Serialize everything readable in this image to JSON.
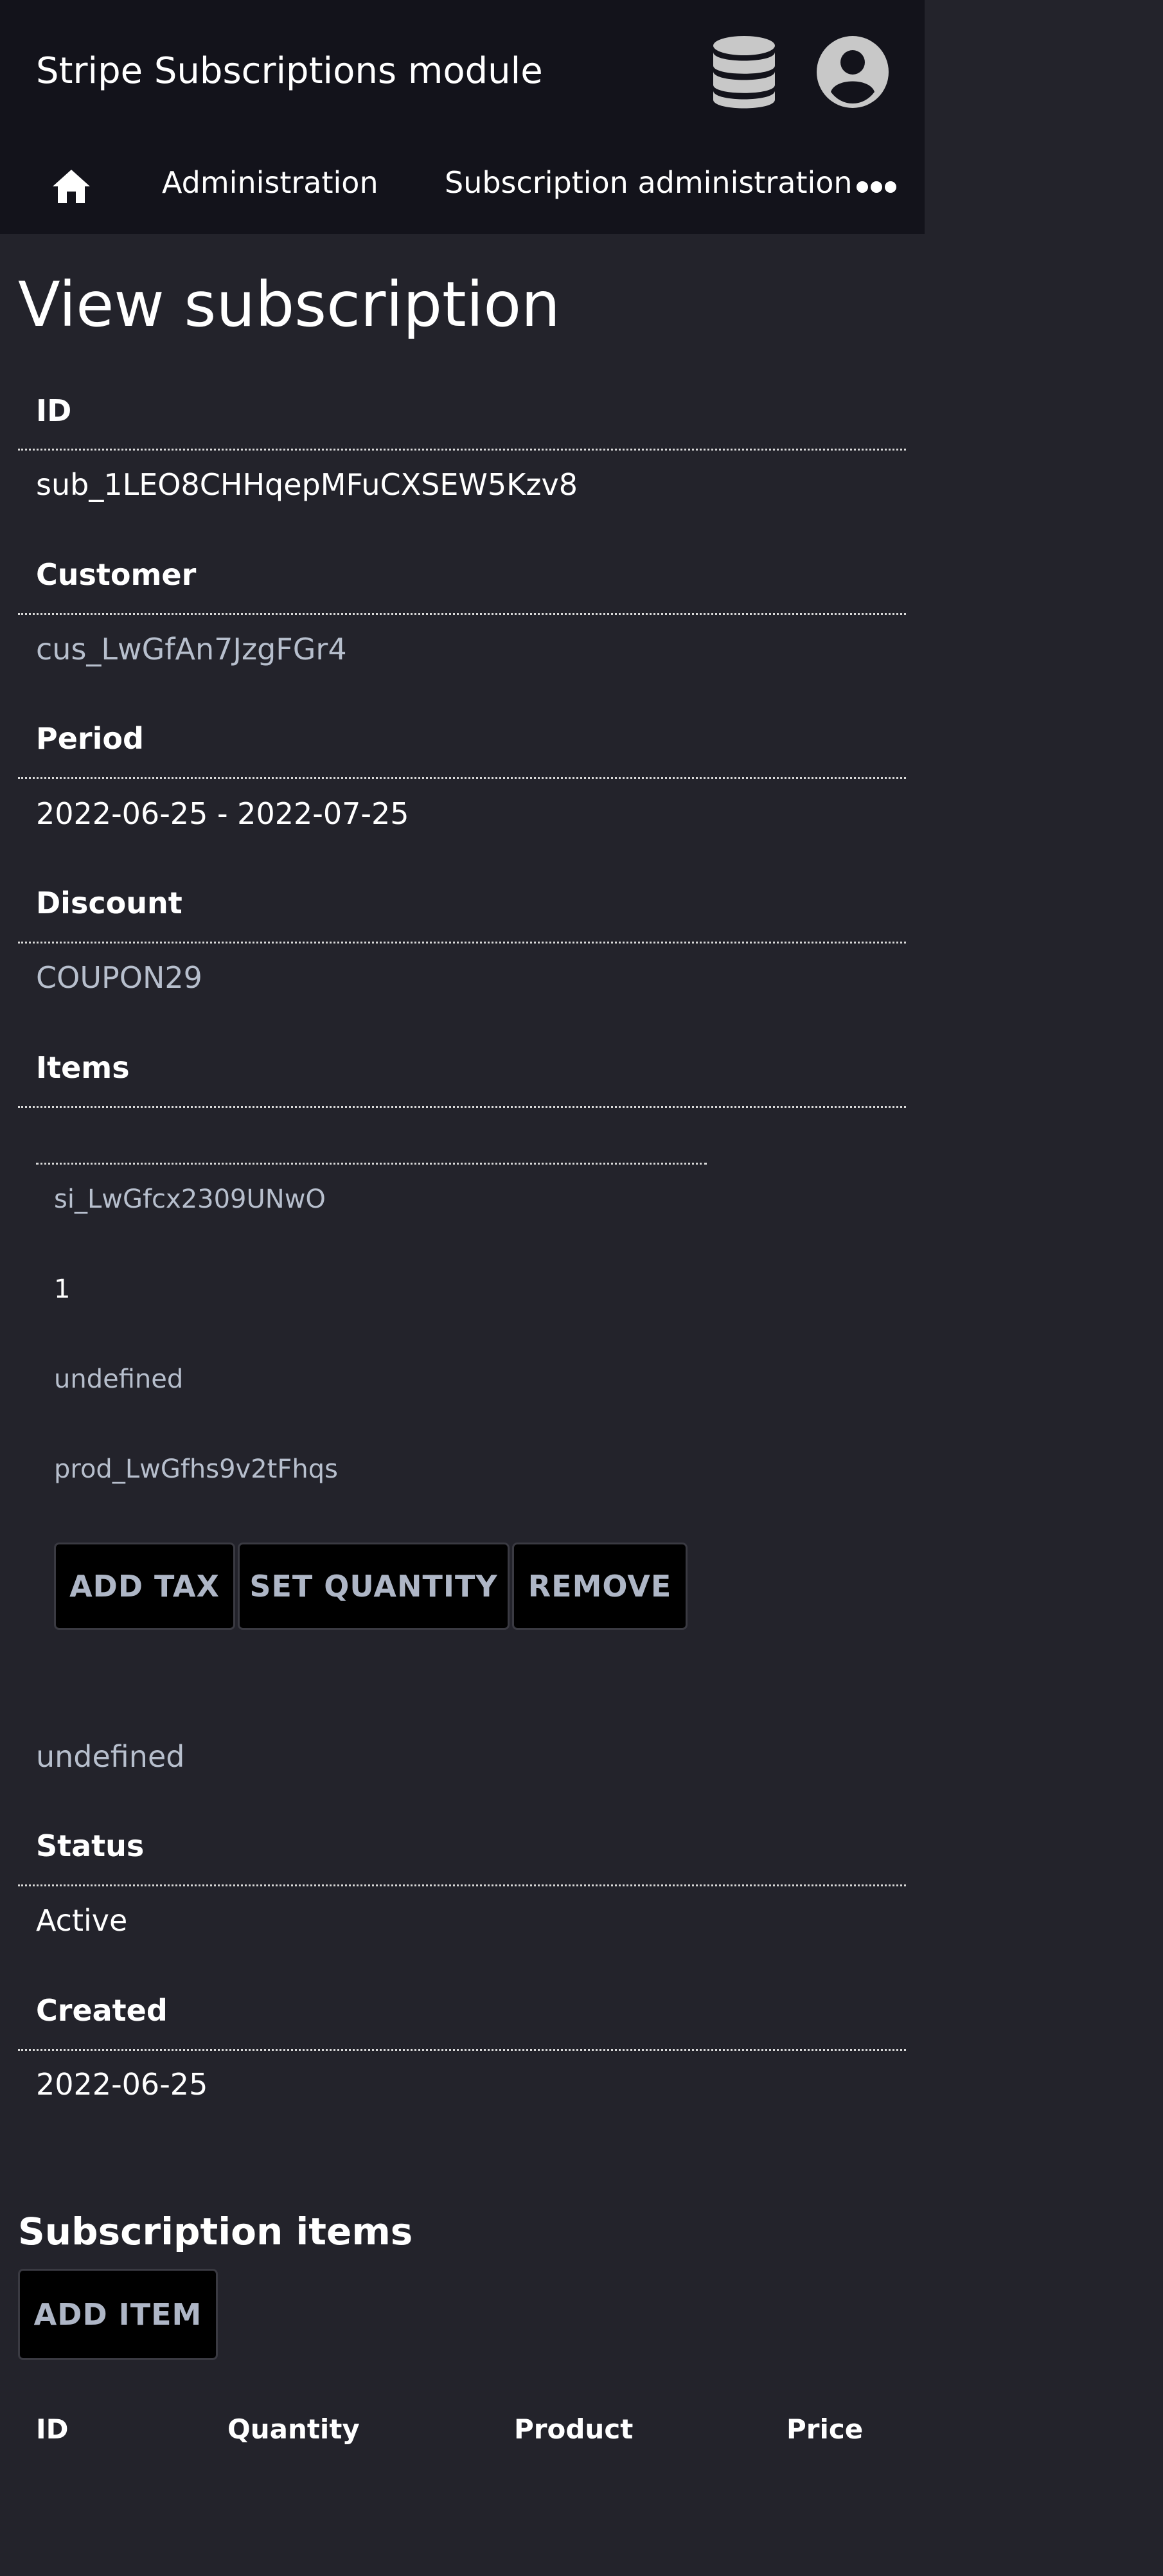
{
  "app": {
    "title": "Stripe Subscriptions module",
    "db_icon": "database-icon",
    "user_icon": "user-circle-icon"
  },
  "nav": {
    "home_icon": "home-icon",
    "items": [
      {
        "label": "Administration"
      },
      {
        "label": "Subscription administration"
      }
    ],
    "more_icon": "more-horizontal-icon"
  },
  "page": {
    "title": "View subscription"
  },
  "fields": {
    "id": {
      "label": "ID",
      "value": "sub_1LEO8CHHqepMFuCXSEW5Kzv8"
    },
    "customer": {
      "label": "Customer",
      "value": "cus_LwGfAn7JzgFGr4"
    },
    "period": {
      "label": "Period",
      "value": "2022-06-25 - 2022-07-25"
    },
    "discount": {
      "label": "Discount",
      "value": "COUPON29"
    },
    "items": {
      "label": "Items",
      "trailing_value": "undefined"
    },
    "status": {
      "label": "Status",
      "value": "Active"
    },
    "created": {
      "label": "Created",
      "value": "2022-06-25"
    }
  },
  "item": {
    "id": "si_LwGfcx2309UNwO",
    "quantity": "1",
    "price": "undefined",
    "product": "prod_LwGfhs9v2tFhqs",
    "buttons": {
      "add_tax": "ADD TAX",
      "set_quantity": "SET QUANTITY",
      "remove": "REMOVE"
    }
  },
  "subscription_items": {
    "title": "Subscription items",
    "add_button": "ADD ITEM",
    "columns": [
      "ID",
      "Quantity",
      "Product",
      "Price"
    ]
  },
  "colors": {
    "background": "#23232b",
    "header_background": "#13131b",
    "link_text": "#b7bfcd",
    "button_background": "#000000",
    "button_text": "#aeb6c6",
    "icon_fill": "#c8c8c8"
  }
}
